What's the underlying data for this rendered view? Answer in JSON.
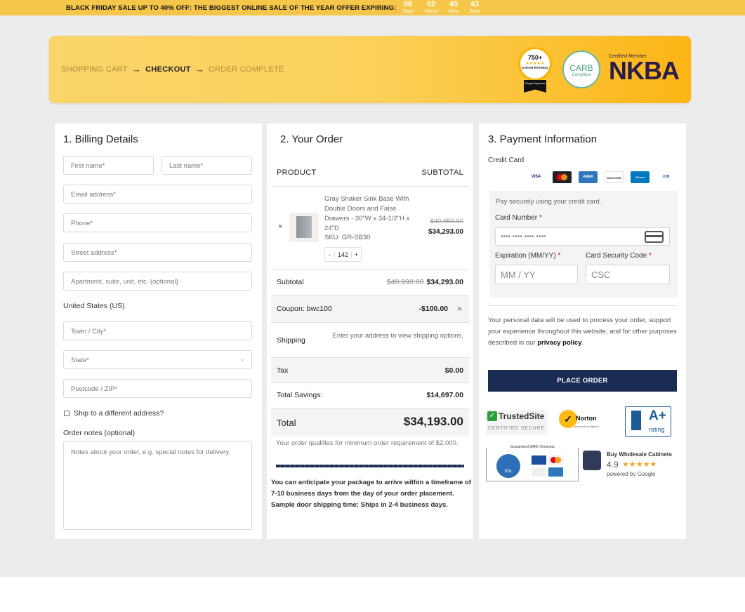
{
  "banner": {
    "promo": "BLACK FRIDAY SALE UP TO 40% OFF: THE BIGGEST ONLINE SALE OF THE YEAR OFFER EXPIRING:",
    "countdown": [
      {
        "value": "08",
        "unit": "Days"
      },
      {
        "value": "02",
        "unit": "Hours"
      },
      {
        "value": "45",
        "unit": "Mins"
      },
      {
        "value": "43",
        "unit": "Secs"
      }
    ]
  },
  "breadcrumb": {
    "step1": "SHOPPING CART",
    "step2": "CHECKOUT",
    "step3": "ORDER COMPLETE"
  },
  "badges": {
    "ratings_count": "750+",
    "ratings_label": "5-STAR RATINGS",
    "ratings_source": "Shopper Approved",
    "carb_top": "CARB",
    "carb_sub": "Compliant",
    "nkba_small": "Certified Member",
    "nkba_big": "NKBA"
  },
  "billing": {
    "title": "1. Billing Details",
    "first_name": "First name*",
    "last_name": "Last name*",
    "email": "Email address*",
    "phone": "Phone*",
    "street": "Street address*",
    "apartment": "Apartment, suite, unit, etc. (optional)",
    "country": "United States (US)",
    "city": "Town / City*",
    "state": "State*",
    "postcode": "Postcode / ZIP*",
    "ship_different": "Ship to a different address?",
    "notes_label": "Order notes (optional)",
    "notes_placeholder": "Notes about your order, e.g. special notes for delivery."
  },
  "order": {
    "title": "2. Your Order",
    "col_product": "PRODUCT",
    "col_subtotal": "SUBTOTAL",
    "remove_symbol": "×",
    "item": {
      "name": "Gray Shaker Sink Base With Double Doors and False Drawers - 30\"W x 34-1/2\"H x 24\"D",
      "sku": "SKU: GR-SB30",
      "qty": "142",
      "minus": "-",
      "plus": "+",
      "old_price": "$40,990.00",
      "price": "$34,293.00"
    },
    "subtotal_label": "Subtotal",
    "subtotal_old": "$40,990.00",
    "subtotal_value": "$34,293.00",
    "coupon_label": "Coupon: bwc100",
    "coupon_value": "-$100.00",
    "coupon_remove": "×",
    "shipping_label": "Shipping",
    "shipping_value": "Enter your address to view shipping options.",
    "tax_label": "Tax",
    "tax_value": "$0.00",
    "savings_label": "Total Savings:",
    "savings_value": "$14,697.00",
    "total_label": "Total",
    "total_value": "$34,193.00",
    "min_note": "Your order qualifies for minimum order requirement of $2,000.",
    "shipping_note_1": "You can anticipate your package to arrive within a timeframe of 7-10 business days from the day of your order placement.",
    "shipping_note_2": "Sample door shipping time: Ships in 2-4 business days."
  },
  "payment": {
    "title": "3. Payment Information",
    "method": "Credit Card",
    "card_brands": [
      "VISA",
      "mastercard",
      "AMEX",
      "DISCOVER",
      "Diners",
      "JCB"
    ],
    "secure_note": "Pay securely using your credit card.",
    "card_number_label": "Card Number",
    "card_number_placeholder": "•••• •••• •••• ••••",
    "expiry_label": "Expiration (MM/YY)",
    "expiry_placeholder": "MM / YY",
    "csc_label": "Card Security Code",
    "csc_placeholder": "CSC",
    "required_mark": "*",
    "privacy_text": "Your personal data will be used to process your order, support your experience throughout this website, and for other purposes described in our",
    "privacy_link": "privacy policy",
    "place_order": "PLACE ORDER",
    "trust": {
      "trustedsite": "TrustedSite",
      "certified": "CERTIFIED SECURE",
      "norton": "Norton",
      "norton_sub": "powered by digicert",
      "bbb": "A+",
      "bbb_sub": "rating",
      "guaranteed": "Guaranteed SAFE Checkout",
      "ssl": "SSL",
      "google_title": "Buy Wholesale Cabinets",
      "google_rating": "4.9",
      "google_powered": "powered by Google"
    }
  }
}
